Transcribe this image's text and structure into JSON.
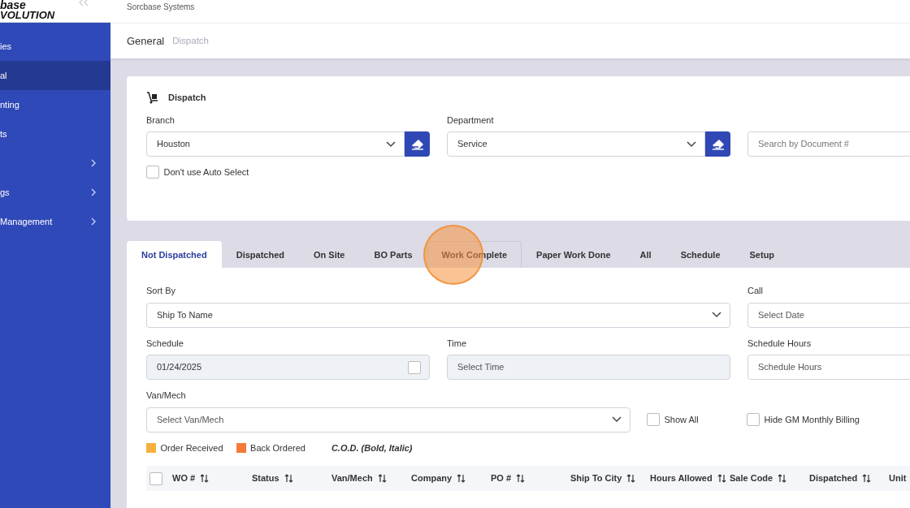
{
  "sidebar": {
    "logo": [
      "base",
      "VOLUTION"
    ],
    "items": [
      {
        "label": "ies",
        "selected": false,
        "expandable": false
      },
      {
        "label": "al",
        "selected": true,
        "expandable": false
      },
      {
        "label": "nting",
        "selected": false,
        "expandable": false
      },
      {
        "label": "ts",
        "selected": false,
        "expandable": false
      },
      {
        "selected": false,
        "expandable": true
      },
      {
        "label": "gs",
        "selected": false,
        "expandable": true
      },
      {
        "label": "Management",
        "selected": false,
        "expandable": true
      }
    ]
  },
  "header": {
    "company": "Sorcbase Systems"
  },
  "breadcrumb": [
    {
      "label": "General",
      "current": true
    },
    {
      "label": "Dispatch",
      "current": false
    }
  ],
  "dispatch_card": {
    "title": "Dispatch",
    "branch": {
      "label": "Branch",
      "value": "Houston"
    },
    "department": {
      "label": "Department",
      "value": "Service"
    },
    "search": {
      "placeholder": "Search by Document #"
    },
    "auto_select": {
      "label": "Don't use Auto Select",
      "checked": false
    }
  },
  "tabs": [
    {
      "label": "Not Dispatched",
      "selected": true,
      "hovered": false
    },
    {
      "label": "Dispatched",
      "selected": false,
      "hovered": false
    },
    {
      "label": "On Site",
      "selected": false,
      "hovered": false
    },
    {
      "label": "BO Parts",
      "selected": false,
      "hovered": false
    },
    {
      "label": "Work Complete",
      "selected": false,
      "hovered": true
    },
    {
      "label": "Paper Work Done",
      "selected": false,
      "hovered": false
    },
    {
      "label": "All",
      "selected": false,
      "hovered": false
    },
    {
      "label": "Schedule",
      "selected": false,
      "hovered": false
    },
    {
      "label": "Setup",
      "selected": false,
      "hovered": false
    }
  ],
  "filters": {
    "sort_by": {
      "label": "Sort By",
      "value": "Ship To Name"
    },
    "call": {
      "label": "Call",
      "placeholder": "Select Date"
    },
    "schedule": {
      "label": "Schedule",
      "value": "01/24/2025"
    },
    "time": {
      "label": "Time",
      "placeholder": "Select Time"
    },
    "schedule_hours": {
      "label": "Schedule Hours",
      "placeholder": "Schedule Hours"
    },
    "van_mech": {
      "label": "Van/Mech",
      "placeholder": "Select Van/Mech"
    },
    "show_all": {
      "label": "Show All",
      "checked": false
    },
    "hide_gm": {
      "label": "Hide GM Monthly Billing",
      "checked": false
    }
  },
  "legend": [
    {
      "label": "Order Received",
      "color": "#f6b13d"
    },
    {
      "label": "Back Ordered",
      "color": "#f47a3a"
    },
    {
      "label": "C.O.D. (Bold, Italic)"
    }
  ],
  "table": {
    "select_all_checked": false,
    "columns": [
      "WO #",
      "Status",
      "Van/Mech",
      "Company",
      "PO #",
      "Ship To City",
      "Hours Allowed",
      "Sale Code",
      "Dispatched",
      "Unit"
    ]
  }
}
